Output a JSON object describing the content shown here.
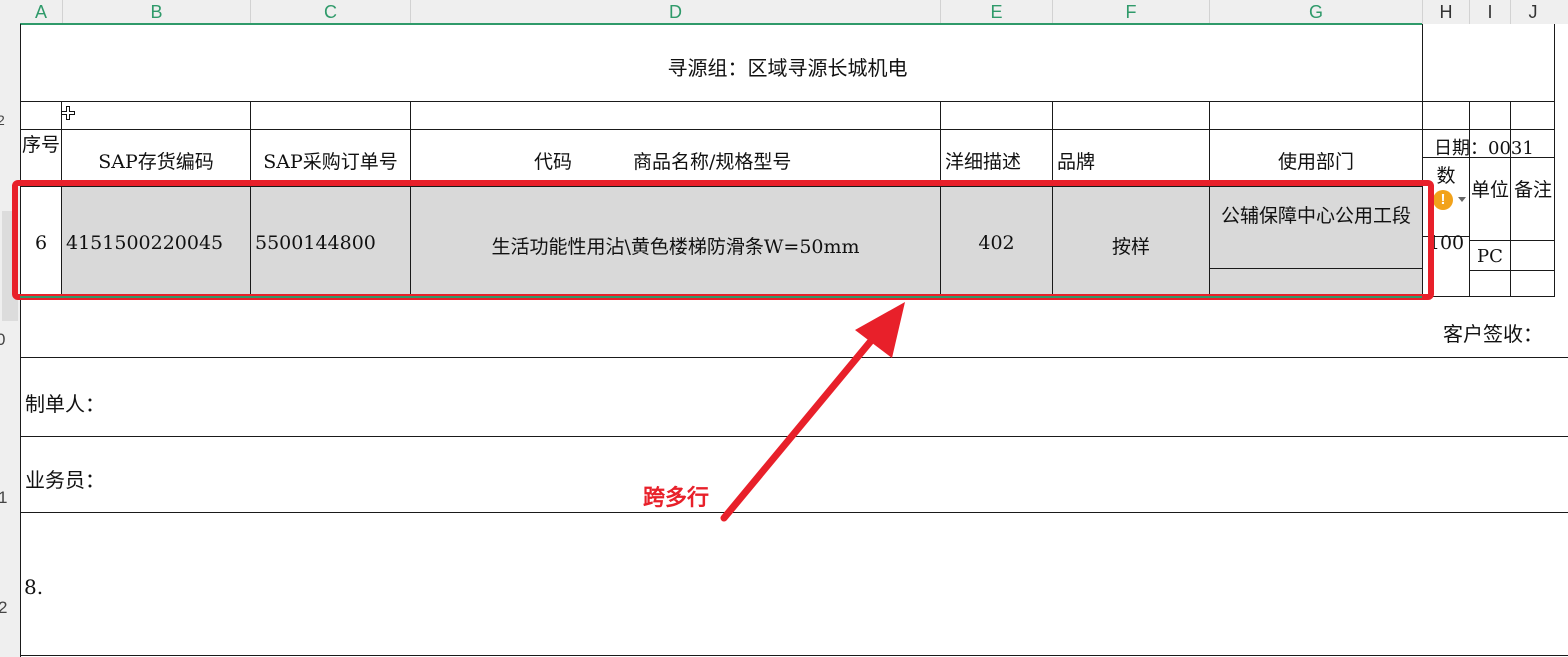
{
  "columns": [
    "A",
    "B",
    "C",
    "D",
    "E",
    "F",
    "G",
    "H",
    "I",
    "J"
  ],
  "rows": [
    "0",
    "1",
    "2",
    "2"
  ],
  "sheet": {
    "title": "寻源组：区域寻源长城机电",
    "headers": {
      "seq": "序号",
      "sap_code": "SAP存货编码",
      "sap_po": "SAP采购订单号",
      "code": "代码",
      "product": "商品名称/规格型号",
      "detail": "洋细描述",
      "brand": "品牌",
      "dept": "使用部门",
      "date": "日期：0031",
      "qty": "数",
      "unit": "单位",
      "note": "备注"
    },
    "record": {
      "seq": "6",
      "sap_code": "4151500220045",
      "sap_po": "5500144800",
      "product": "生活功能性用沾\\黄色楼梯防滑条W=50mm",
      "detail": "402",
      "brand": "按样",
      "dept": "公辅保障中心公用工段",
      "qty": "100",
      "unit": "PC"
    },
    "customer_sign": "客户签收：",
    "maker": "制单人：",
    "salesman": "业务员：",
    "footer_num": "8."
  },
  "annotation": {
    "label": "跨多行",
    "color": "#e8202a"
  },
  "icons": {
    "warning": "warning-icon",
    "dropdown": "chevron-down-icon",
    "cursor": "crosshair-cursor-icon"
  }
}
